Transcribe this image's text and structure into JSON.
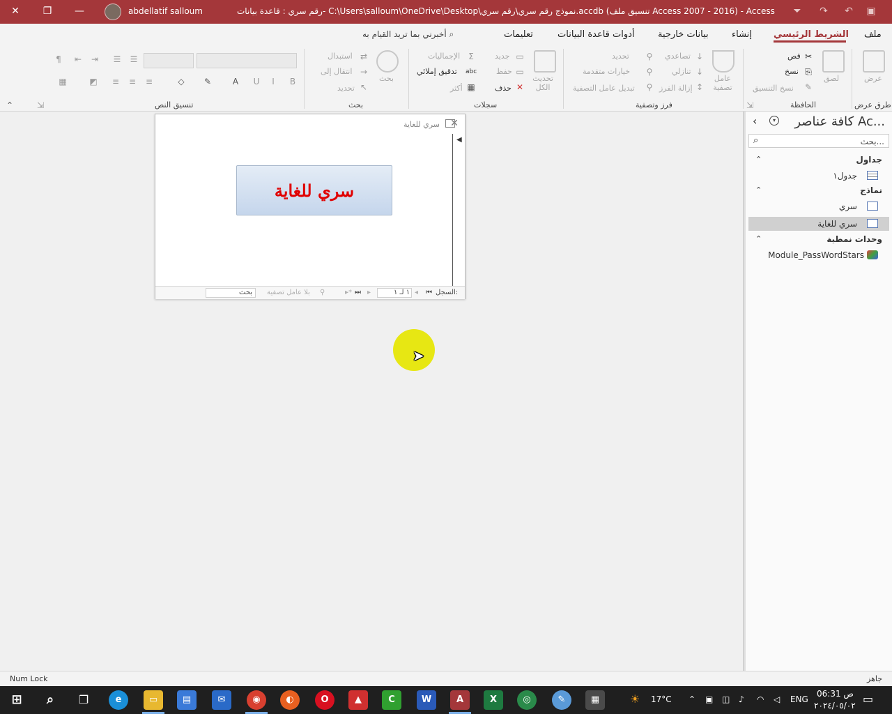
{
  "titlebar": {
    "title": "رقم سري : قاعدة بيانات- C:\\Users\\salloum\\OneDrive\\Desktop\\نموذج رقم سري\\رقم سري.accdb (تنسيق ملف Access 2007 - 2016)  -  Access",
    "user": "abdellatif salloum"
  },
  "tabs": {
    "file": "ملف",
    "home": "الشريط الرئيسي",
    "create": "إنشاء",
    "external": "بيانات خارجية",
    "dbtools": "أدوات قاعدة البيانات",
    "help": "تعليمات",
    "tell_me": "أخبرني بما تريد القيام به"
  },
  "ribbon": {
    "views": {
      "label": "طرق عرض",
      "view": "عرض"
    },
    "clipboard": {
      "label": "الحافظة",
      "paste": "لصق",
      "cut": "قص",
      "copy": "نسخ",
      "format_painter": "نسخ التنسيق"
    },
    "sort_filter": {
      "label": "فرز وتصفية",
      "filter": "عامل تصفية",
      "ascending": "تصاعدي",
      "descending": "تنازلي",
      "remove_sort": "إزالة الفرز",
      "selection": "تحديد",
      "advanced": "خيارات متقدمة",
      "toggle_filter": "تبديل عامل التصفية"
    },
    "records": {
      "label": "سجلات",
      "refresh_all": "تحديث الكل",
      "new": "جديد",
      "save": "حفظ",
      "delete": "حذف",
      "totals": "الإجماليات",
      "spelling": "تدقيق إملائي",
      "more": "أكثر"
    },
    "find": {
      "label": "بحث",
      "find": "بحث",
      "replace": "استبدال",
      "goto": "انتقال إلى",
      "select": "تحديد"
    },
    "text_format": {
      "label": "تنسيق النص"
    }
  },
  "form_window": {
    "title": "سري للغاية",
    "button_label": "سري للغاية",
    "recnav": {
      "record_label": "السجل:",
      "position": "١ لـ ١",
      "no_filter": "بلا عامل تصفية",
      "search": "بحث"
    }
  },
  "nav_pane": {
    "title": "كافة عناصر Ac...",
    "search_placeholder": "بحث...",
    "groups": [
      {
        "label": "جداول",
        "items": [
          {
            "label": "جدول١"
          }
        ]
      },
      {
        "label": "نماذج",
        "items": [
          {
            "label": "سري"
          },
          {
            "label": "سري للغاية"
          }
        ]
      },
      {
        "label": "وحدات نمطية",
        "items": [
          {
            "label": "Module_PassWordStars"
          }
        ]
      }
    ]
  },
  "statusbar": {
    "left": "Num Lock",
    "right": "جاهز"
  },
  "taskbar": {
    "weather": "17°C",
    "lang": "ENG",
    "time": "06:31 ص",
    "date": "٢٠٢٤/٠٥/٠٢"
  },
  "colors": {
    "accent": "#a4373a",
    "button_text": "#e00000",
    "highlight": "#e6e600"
  }
}
